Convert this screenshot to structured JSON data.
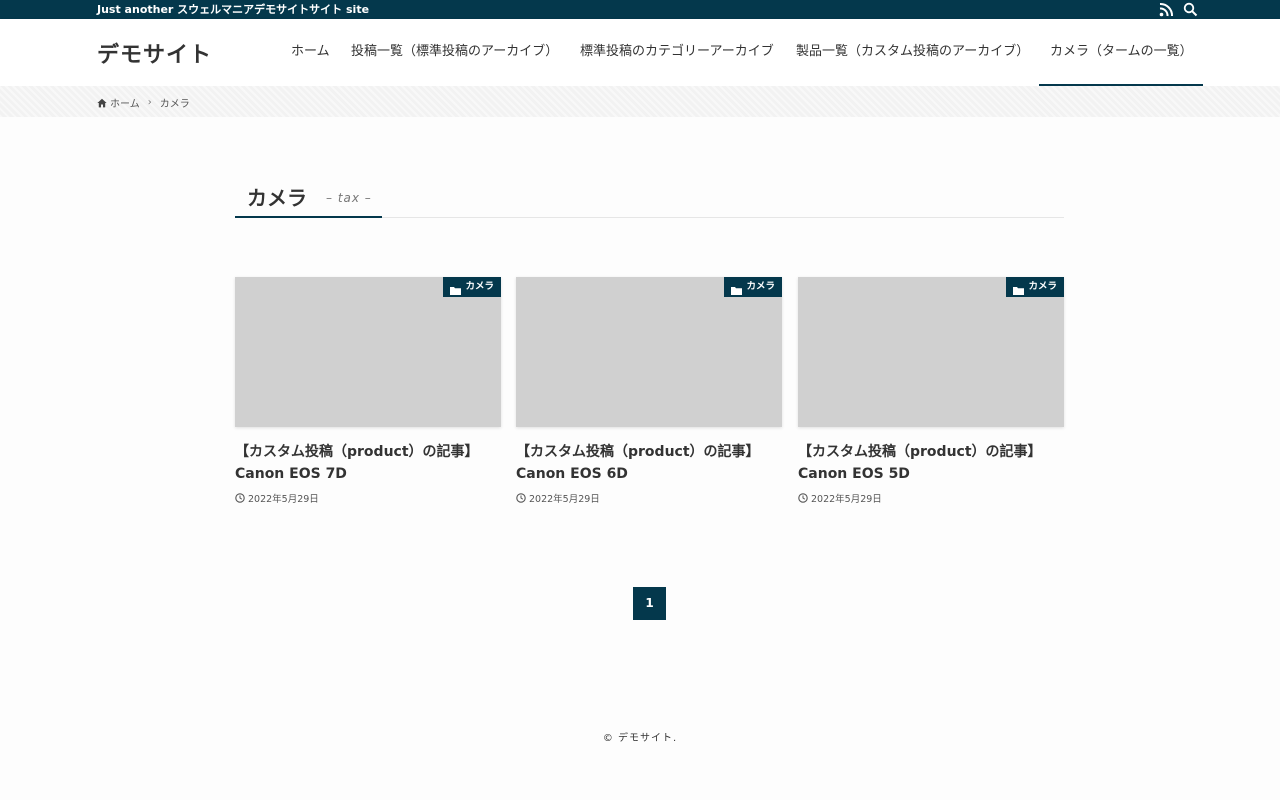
{
  "topbar": {
    "tagline": "Just another スウェルマニアデモサイトサイト site",
    "icons": [
      "rss-icon",
      "search-icon"
    ]
  },
  "header": {
    "logo": "デモサイト",
    "nav": [
      {
        "label": "ホーム",
        "active": false
      },
      {
        "label": "投稿一覧（標準投稿のアーカイブ）",
        "active": false
      },
      {
        "label": "標準投稿のカテゴリーアーカイブ",
        "active": false
      },
      {
        "label": "製品一覧（カスタム投稿のアーカイブ）",
        "active": false
      },
      {
        "label": "カメラ（タームの一覧）",
        "active": true
      }
    ]
  },
  "breadcrumb": {
    "items": [
      "ホーム",
      "カメラ"
    ]
  },
  "archive": {
    "title": "カメラ",
    "subtitle": "– tax –"
  },
  "posts": [
    {
      "category": "カメラ",
      "title": "【カスタム投稿（product）の記事】Canon EOS 7D",
      "date": "2022年5月29日"
    },
    {
      "category": "カメラ",
      "title": "【カスタム投稿（product）の記事】Canon EOS 6D",
      "date": "2022年5月29日"
    },
    {
      "category": "カメラ",
      "title": "【カスタム投稿（product）の記事】Canon EOS 5D",
      "date": "2022年5月29日"
    }
  ],
  "pagination": {
    "current": "1"
  },
  "footer": {
    "copyright": "© デモサイト."
  },
  "colors": {
    "primary": "#04384c",
    "thumbnail": "#d0d0d0"
  }
}
